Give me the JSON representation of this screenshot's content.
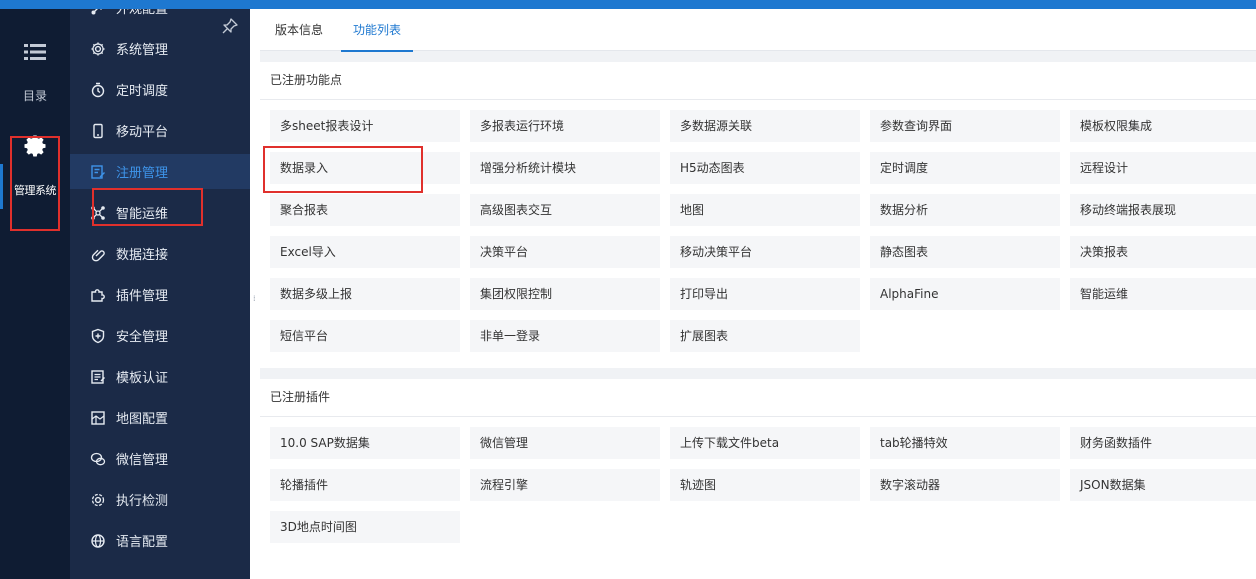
{
  "rail": {
    "catalog_label": "目录",
    "admin_label": "管理系统"
  },
  "menu": {
    "items": [
      {
        "label": "外观配置",
        "icon": "brush-icon"
      },
      {
        "label": "系统管理",
        "icon": "gear-icon"
      },
      {
        "label": "定时调度",
        "icon": "timer-icon"
      },
      {
        "label": "移动平台",
        "icon": "mobile-icon"
      },
      {
        "label": "注册管理",
        "icon": "register-icon"
      },
      {
        "label": "智能运维",
        "icon": "network-icon"
      },
      {
        "label": "数据连接",
        "icon": "link-icon"
      },
      {
        "label": "插件管理",
        "icon": "puzzle-icon"
      },
      {
        "label": "安全管理",
        "icon": "shield-icon"
      },
      {
        "label": "模板认证",
        "icon": "template-icon"
      },
      {
        "label": "地图配置",
        "icon": "map-icon"
      },
      {
        "label": "微信管理",
        "icon": "wechat-icon"
      },
      {
        "label": "执行检测",
        "icon": "check-icon"
      },
      {
        "label": "语言配置",
        "icon": "globe-icon"
      }
    ],
    "active_index": 4
  },
  "tabs": [
    {
      "label": "版本信息"
    },
    {
      "label": "功能列表"
    }
  ],
  "features": {
    "title": "已注册功能点",
    "items": [
      "多sheet报表设计",
      "多报表运行环境",
      "多数据源关联",
      "参数查询界面",
      "模板权限集成",
      "数据录入",
      "增强分析统计模块",
      "H5动态图表",
      "定时调度",
      "远程设计",
      "聚合报表",
      "高级图表交互",
      "地图",
      "数据分析",
      "移动终端报表展现",
      "Excel导入",
      "决策平台",
      "移动决策平台",
      "静态图表",
      "决策报表",
      "数据多级上报",
      "集团权限控制",
      "打印导出",
      "AlphaFine",
      "智能运维",
      "短信平台",
      "非单一登录",
      "扩展图表"
    ]
  },
  "plugins": {
    "title": "已注册插件",
    "items": [
      "10.0 SAP数据集",
      "微信管理",
      "上传下载文件beta",
      "tab轮播特效",
      "财务函数插件",
      "轮播插件",
      "流程引擎",
      "轨迹图",
      "数字滚动器",
      "JSON数据集",
      "3D地点时间图"
    ]
  },
  "colors": {
    "accent": "#1e78d0",
    "highlight": "#e0302c",
    "rail_bg": "#0f1c33",
    "menu_bg": "#1b2a47"
  }
}
